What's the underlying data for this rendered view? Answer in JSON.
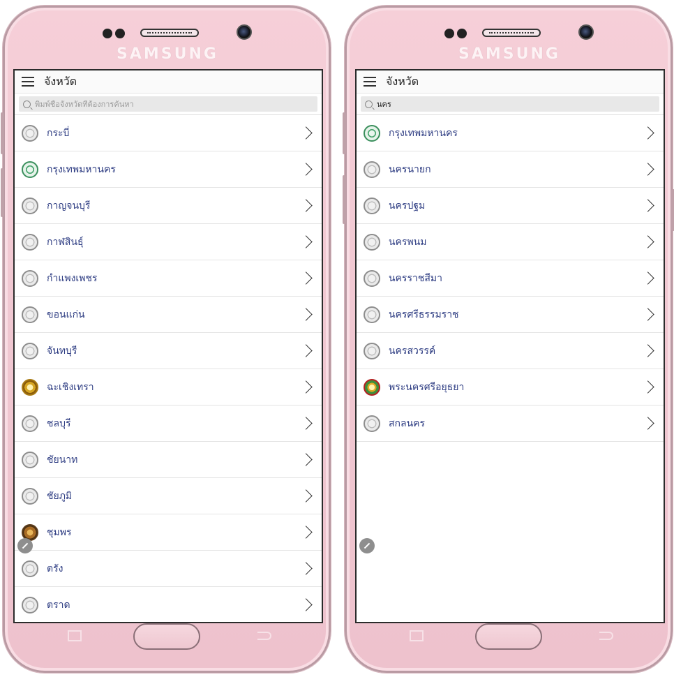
{
  "brand": "SAMSUNG",
  "colors": {
    "phone_body": "#f0c7d1",
    "list_text": "#2d3c82",
    "appbar_bg": "#fafafa"
  },
  "left": {
    "title": "จังหวัด",
    "search_value": "",
    "search_placeholder": "พิมพ์ชื่อจังหวัดที่ต้องการค้นหา",
    "items": [
      {
        "label": "กระบี่",
        "seal": "gray-seal-icon"
      },
      {
        "label": "กรุงเทพมหานคร",
        "seal": "green-seal-icon"
      },
      {
        "label": "กาญจนบุรี",
        "seal": "gray-seal-icon"
      },
      {
        "label": "กาฬสินธุ์",
        "seal": "gray-seal-icon"
      },
      {
        "label": "กำแพงเพชร",
        "seal": "gray-seal-icon"
      },
      {
        "label": "ขอนแก่น",
        "seal": "gray-seal-icon"
      },
      {
        "label": "จันทบุรี",
        "seal": "gray-seal-icon"
      },
      {
        "label": "ฉะเชิงเทรา",
        "seal": "gold-seal-icon"
      },
      {
        "label": "ชลบุรี",
        "seal": "gray-seal-icon"
      },
      {
        "label": "ชัยนาท",
        "seal": "gray-seal-icon"
      },
      {
        "label": "ชัยภูมิ",
        "seal": "gray-seal-icon"
      },
      {
        "label": "ชุมพร",
        "seal": "brown-seal-icon"
      },
      {
        "label": "ตรัง",
        "seal": "gray-seal-icon"
      },
      {
        "label": "ตราด",
        "seal": "gray-seal-icon"
      }
    ]
  },
  "right": {
    "title": "จังหวัด",
    "search_value": "นคร",
    "search_placeholder": "",
    "items": [
      {
        "label": "กรุงเทพมหานคร",
        "seal": "green-seal-icon"
      },
      {
        "label": "นครนายก",
        "seal": "gray-seal-icon"
      },
      {
        "label": "นครปฐม",
        "seal": "gray-seal-icon"
      },
      {
        "label": "นครพนม",
        "seal": "gray-seal-icon"
      },
      {
        "label": "นครราชสีมา",
        "seal": "gray-seal-icon"
      },
      {
        "label": "นครศรีธรรมราช",
        "seal": "gray-seal-icon"
      },
      {
        "label": "นครสวรรค์",
        "seal": "gray-seal-icon"
      },
      {
        "label": "พระนครศรีอยุธยา",
        "seal": "red-seal-icon"
      },
      {
        "label": "สกลนคร",
        "seal": "gray-seal-icon"
      }
    ]
  }
}
